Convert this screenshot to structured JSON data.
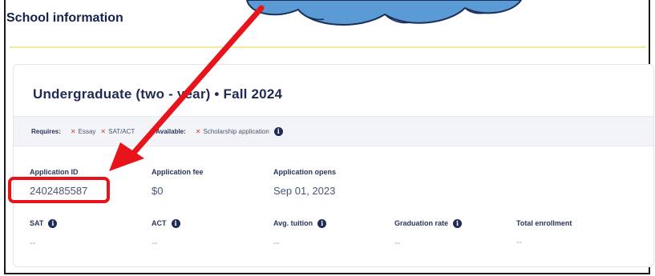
{
  "section": {
    "title": "School information"
  },
  "card": {
    "title": "Undergraduate (two - year) • Fall 2024",
    "requires": {
      "label": "Requires:",
      "items": [
        "Essay",
        "SAT/ACT"
      ]
    },
    "available": {
      "label": "Available:",
      "items": [
        "Scholarship application"
      ]
    },
    "fields_row1": [
      {
        "label": "Application ID",
        "value": "2402485587"
      },
      {
        "label": "Application fee",
        "value": "$0"
      },
      {
        "label": "Application opens",
        "value": "Sep 01, 2023"
      }
    ],
    "fields_row2": [
      {
        "label": "SAT",
        "value": "--"
      },
      {
        "label": "ACT",
        "value": "--"
      },
      {
        "label": "Avg. tuition",
        "value": "--"
      },
      {
        "label": "Graduation rate",
        "value": "--"
      },
      {
        "label": "Total enrollment",
        "value": "--"
      }
    ]
  },
  "colors": {
    "title": "#14224d",
    "accent_line": "#f2e9a6",
    "annotation_red": "#e8141b",
    "cloud_fill": "#5b9bd5"
  },
  "icons": {
    "info": "info-circle-icon",
    "cross": "cross-icon"
  }
}
